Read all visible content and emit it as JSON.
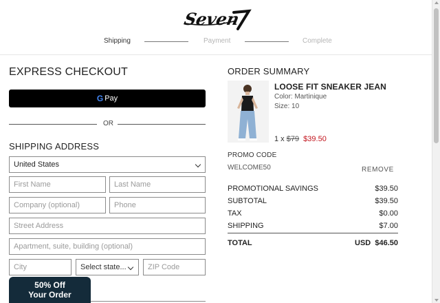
{
  "header": {
    "brand": "Seven7",
    "steps": [
      {
        "label": "Shipping",
        "state": "active"
      },
      {
        "label": "Payment",
        "state": "inactive"
      },
      {
        "label": "Complete",
        "state": "inactive"
      }
    ]
  },
  "express": {
    "title": "EXPRESS CHECKOUT",
    "gpay_label": "Pay",
    "gpay_g": "G",
    "or": "OR"
  },
  "shipping": {
    "title": "SHIPPING ADDRESS",
    "country": "United States",
    "first_name_placeholder": "First Name",
    "last_name_placeholder": "Last Name",
    "company_placeholder": "Company (optional)",
    "phone_placeholder": "Phone",
    "street_placeholder": "Street Address",
    "apartment_placeholder": "Apartment, suite, building (optional)",
    "city_placeholder": "City",
    "state_placeholder": "Select state...",
    "zip_placeholder": "ZIP Code"
  },
  "promo_badge": {
    "line1": "50% Off",
    "line2": "Your Order"
  },
  "order_summary": {
    "title": "ORDER SUMMARY",
    "item": {
      "name": "LOOSE FIT SNEAKER JEAN",
      "color": "Color: Martinique",
      "size": "Size: 10",
      "qty": "1 x",
      "original_price": "$79",
      "sale_price": "$39.50"
    },
    "promo_label": "PROMO CODE",
    "promo_code": "WELCOME50",
    "remove_label": "REMOVE",
    "rows": [
      {
        "label": "PROMOTIONAL SAVINGS",
        "value": "$39.50"
      },
      {
        "label": "SUBTOTAL",
        "value": "$39.50"
      },
      {
        "label": "TAX",
        "value": "$0.00"
      },
      {
        "label": "SHIPPING",
        "value": "$7.00"
      }
    ],
    "total_label": "TOTAL",
    "total_value": "USD  $46.50"
  },
  "colors": {
    "sale_red": "#c2141d",
    "badge_navy": "#142b3a",
    "gpay_black": "#000000"
  }
}
